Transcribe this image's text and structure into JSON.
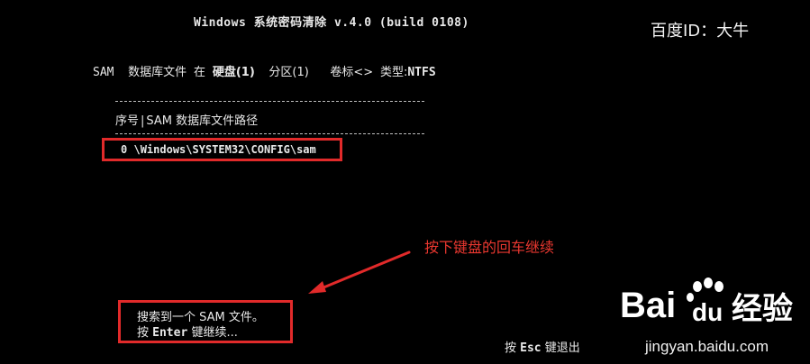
{
  "window": {
    "title": "Windows 系统密码清除 v.4.0 (build 0108)"
  },
  "watermark": {
    "author": "百度ID：大牛",
    "brand_latin": "Bai",
    "brand_du": "du",
    "brand_cn": "经验",
    "url": "jingyan.baidu.com"
  },
  "disk_info": {
    "sam_label": "SAM",
    "db_file_label": "数据库文件",
    "at_label": "在",
    "disk_label": "硬盘(1)",
    "partition_label": "分区(1)",
    "volume_label": "卷标<>",
    "type_label": "类型:",
    "type_value": "NTFS"
  },
  "table": {
    "columns": [
      "序号",
      "SAM 数据库文件路径"
    ],
    "rows": [
      {
        "index": "0",
        "path": "\\Windows\\SYSTEM32\\CONFIG\\sam"
      }
    ]
  },
  "annotation": {
    "text": "按下键盘的回车继续",
    "color": "#e8372f"
  },
  "result": {
    "line1": "搜索到一个 SAM 文件。",
    "line2_prefix": "按",
    "line2_key": "Enter",
    "line2_suffix": "键继续..."
  },
  "footer": {
    "esc_prefix": "按",
    "esc_key": "Esc",
    "esc_suffix": "键退出"
  },
  "colors": {
    "background": "#000000",
    "text": "#e8e8e8",
    "highlight_border": "#e12a2a",
    "baidu_blue": "#2f6fd6"
  }
}
